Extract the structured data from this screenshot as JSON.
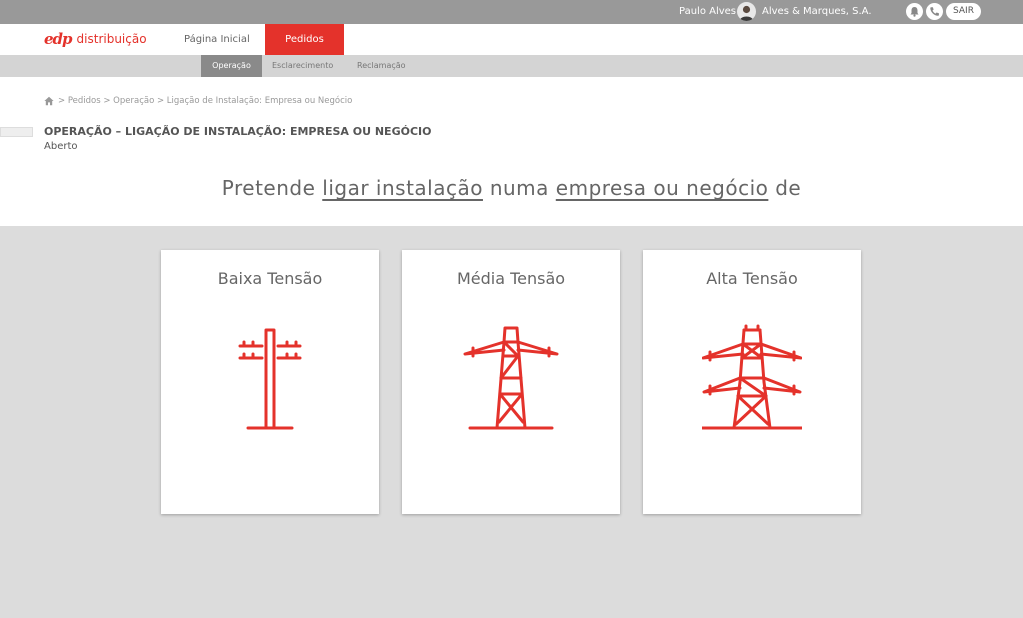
{
  "topbar": {
    "user_name": "Paulo Alves",
    "company": "Alves & Marques, S.A.",
    "logout_label": "SAIR"
  },
  "brand": {
    "logo_mark": "edp",
    "logo_text": "distribuição",
    "accent_color": "#e4322b"
  },
  "nav": {
    "items": [
      {
        "label": "Página Inicial",
        "active": false
      },
      {
        "label": "Pedidos",
        "active": true
      }
    ]
  },
  "subnav": {
    "items": [
      {
        "label": "Operação",
        "active": true
      },
      {
        "label": "Esclarecimento",
        "active": false
      },
      {
        "label": "Reclamação",
        "active": false
      }
    ]
  },
  "breadcrumb": {
    "text": "> Pedidos > Operação > Ligação de Instalação: Empresa ou Negócio"
  },
  "page": {
    "title": "OPERAÇÃO – LIGAÇÃO DE INSTALAÇÃO: EMPRESA OU NEGÓCIO",
    "status": "Aberto"
  },
  "question": {
    "part1": "Pretende ",
    "link1": "ligar instalação",
    "part2": " numa ",
    "link2": "empresa ou negócio",
    "part3": " de"
  },
  "options": [
    {
      "label": "Baixa Tensão",
      "icon": "low-voltage-pole-icon"
    },
    {
      "label": "Média Tensão",
      "icon": "medium-voltage-tower-icon"
    },
    {
      "label": "Alta Tensão",
      "icon": "high-voltage-tower-icon"
    }
  ]
}
